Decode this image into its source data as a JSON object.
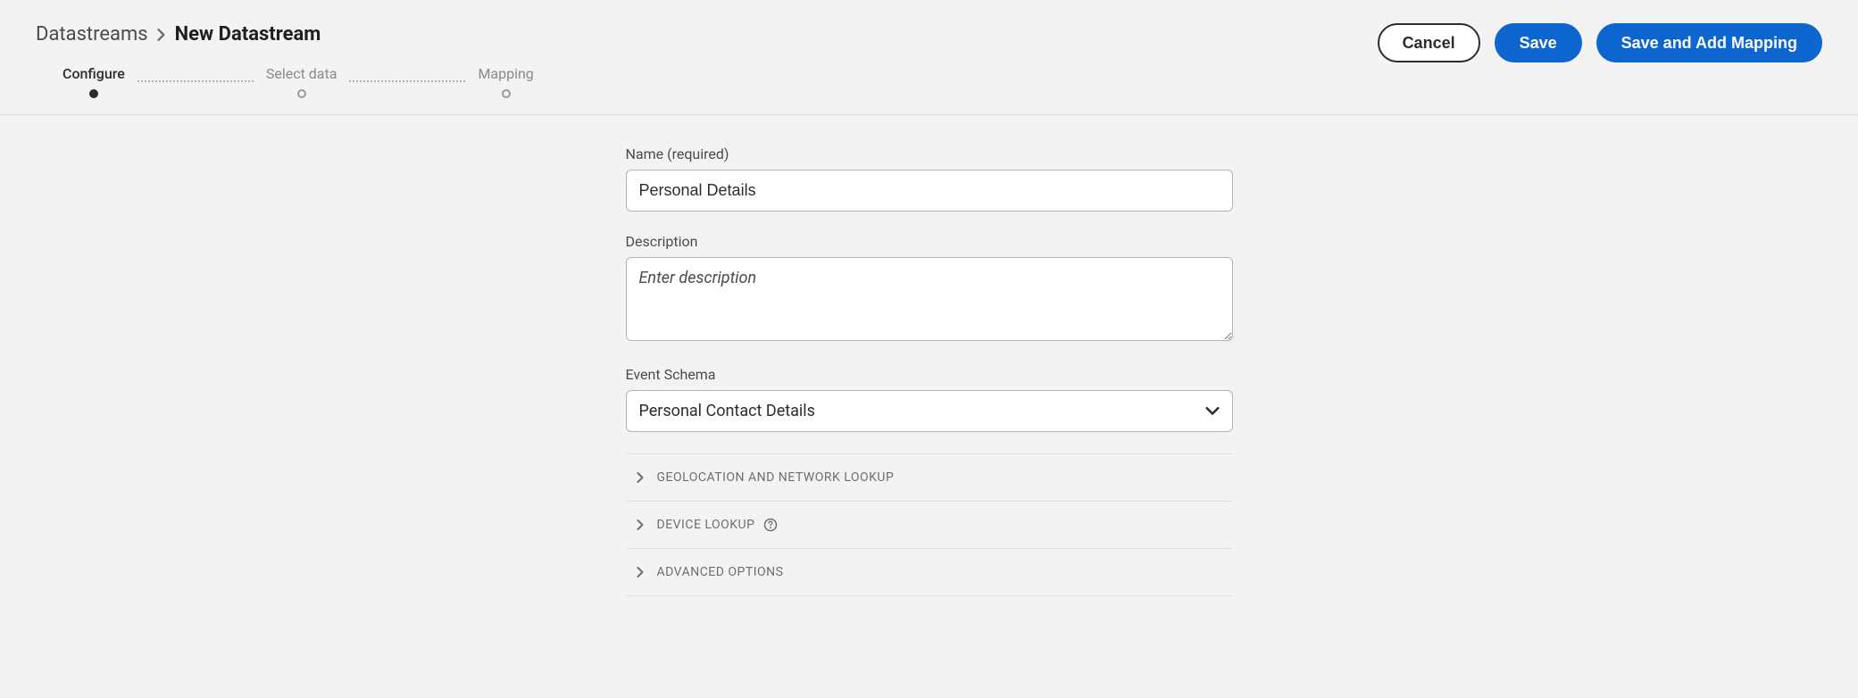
{
  "breadcrumb": {
    "parent": "Datastreams",
    "current": "New Datastream"
  },
  "actions": {
    "cancel": "Cancel",
    "save": "Save",
    "saveAddMapping": "Save and Add Mapping"
  },
  "stepper": {
    "steps": [
      {
        "label": "Configure",
        "active": true
      },
      {
        "label": "Select data",
        "active": false
      },
      {
        "label": "Mapping",
        "active": false
      }
    ]
  },
  "form": {
    "nameLabel": "Name (required)",
    "nameValue": "Personal Details",
    "descriptionLabel": "Description",
    "descriptionPlaceholder": "Enter description",
    "descriptionValue": "",
    "eventSchemaLabel": "Event Schema",
    "eventSchemaValue": "Personal Contact Details"
  },
  "accordion": {
    "items": [
      {
        "label": "Geolocation and Network Lookup",
        "help": false
      },
      {
        "label": "Device Lookup",
        "help": true
      },
      {
        "label": "Advanced Options",
        "help": false
      }
    ]
  }
}
